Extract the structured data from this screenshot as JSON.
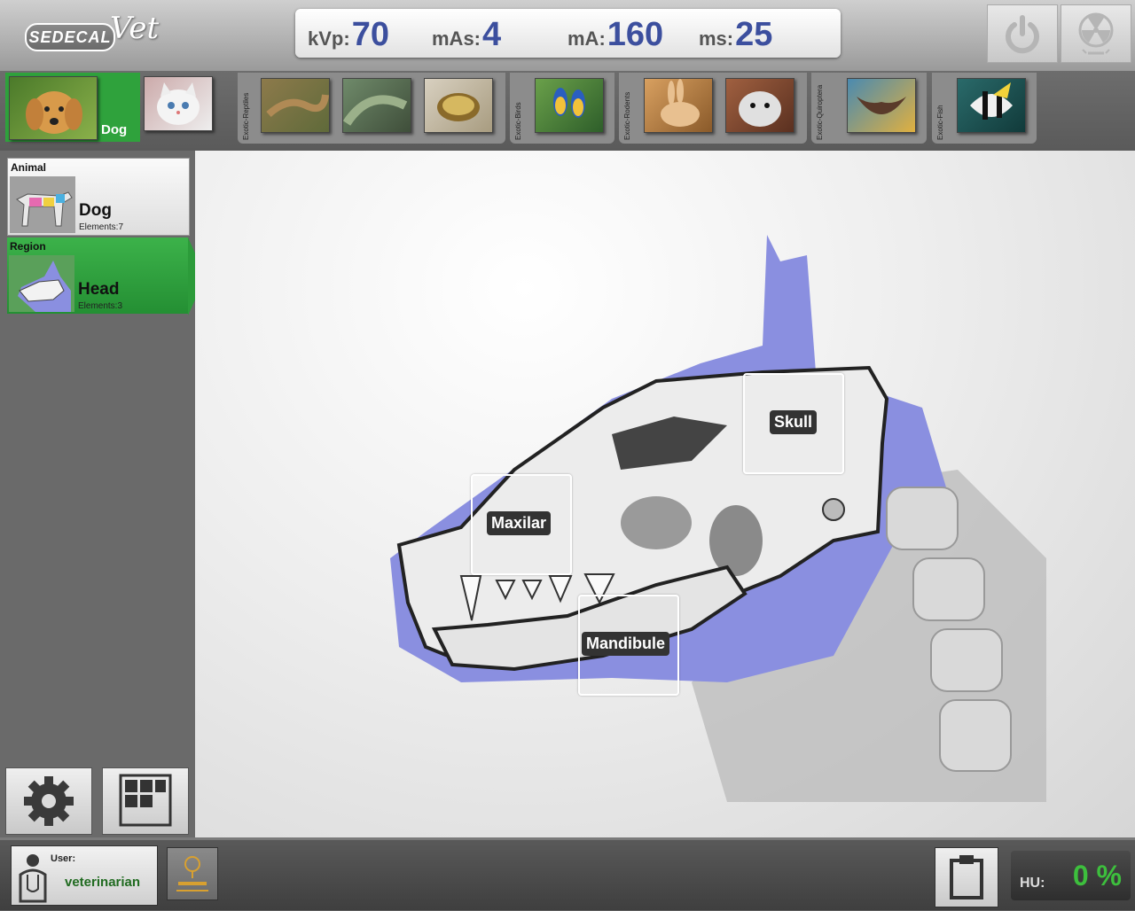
{
  "app": {
    "logo_text": "SEDECAL",
    "logo_script": "Vet"
  },
  "params": {
    "kvp_label": "kVp:",
    "kvp_value": "70",
    "mas_label": "mAs:",
    "mas_value": "4",
    "ma_label": "mA:",
    "ma_value": "160",
    "ms_label": "ms:",
    "ms_value": "25"
  },
  "top_buttons": [
    {
      "icon": "power-icon"
    },
    {
      "icon": "radiation-icon"
    }
  ],
  "animals": {
    "selected_label": "Dog",
    "categories": [
      {
        "label": "Exotic-Reptiles"
      },
      {
        "label": "Exotic-Birds"
      },
      {
        "label": "Exotic-Rodents"
      },
      {
        "label": "Exotic-Quiroptera"
      },
      {
        "label": "Exotic-Fish"
      }
    ]
  },
  "sidebar": {
    "animal_title": "Animal",
    "animal_name": "Dog",
    "animal_elements": "Elements:7",
    "region_title": "Region",
    "region_name": "Head",
    "region_elements": "Elements:3"
  },
  "regions": [
    {
      "label": "Skull"
    },
    {
      "label": "Maxilar"
    },
    {
      "label": "Mandibule"
    }
  ],
  "bottom": {
    "user_label": "User:",
    "user_name": "veterinarian",
    "hu_label": "HU:",
    "hu_value": "0 %"
  },
  "colors": {
    "accent_green": "#2fa23c",
    "param_blue": "#3c4f9e",
    "head_overlay": "#8a8fe0"
  }
}
